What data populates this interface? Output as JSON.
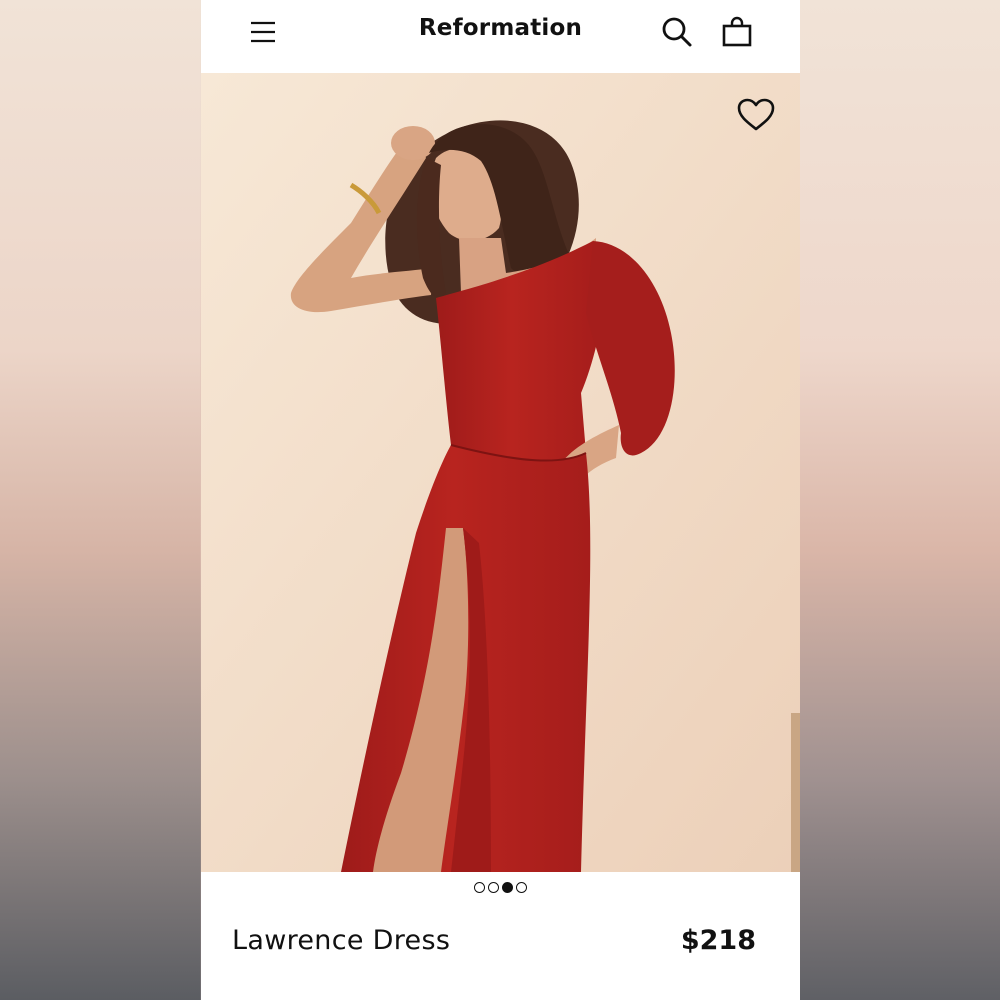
{
  "header": {
    "brand": "Reformation",
    "icons": {
      "menu": "hamburger-menu-icon",
      "search": "search-icon",
      "bag": "shopping-bag-icon"
    }
  },
  "hero": {
    "wishlist_icon": "heart-outline-icon",
    "dress_color": "#b3211f",
    "background_color": "#f3dcc6"
  },
  "carousel": {
    "total": 4,
    "active_index": 2
  },
  "product": {
    "name": "Lawrence Dress",
    "price": "$218"
  }
}
